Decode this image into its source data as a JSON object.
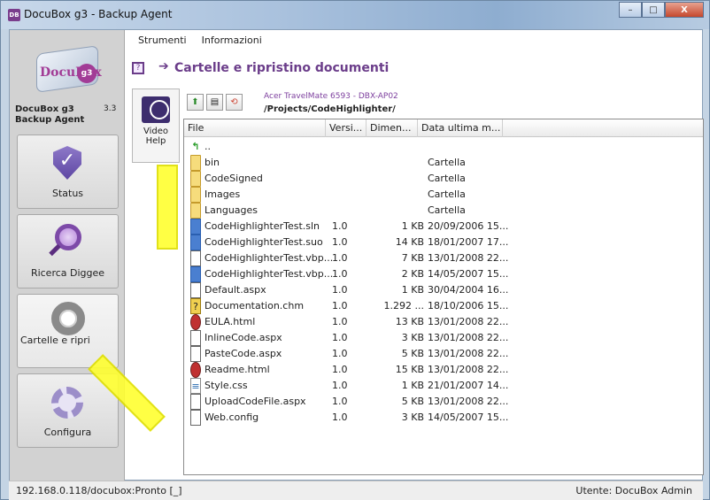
{
  "window": {
    "title": "DocuBox g3 - Backup Agent",
    "minimize_label": "–",
    "maximize_label": "□",
    "close_label": "X"
  },
  "menu": [
    {
      "label": "Strumenti"
    },
    {
      "label": "Informazioni"
    }
  ],
  "sidebar": {
    "logo_text": "DocuBox",
    "logo_badge": "g3",
    "app_name": "DocuBox g3 Backup Agent",
    "version": "3.3",
    "items": [
      {
        "label": "Status",
        "icon": "shield-check-icon"
      },
      {
        "label": "Ricerca Diggee",
        "icon": "magnifier-icon"
      },
      {
        "label": "Cartelle e ripri",
        "icon": "lifebuoy-icon"
      },
      {
        "label": "Configura",
        "icon": "gear-icon"
      }
    ]
  },
  "main": {
    "page_title": "Cartelle e ripristino documenti",
    "video_help_label": "Video Help",
    "machine": "Acer TravelMate 6593 - DBX-AP02",
    "path": "/Projects/CodeHighlighter/",
    "columns": {
      "file": "File",
      "version": "Versi...",
      "size": "Dimen...",
      "date": "Data ultima m..."
    },
    "files": [
      {
        "icon": "up",
        "name": "..",
        "version": "",
        "size": "",
        "date": ""
      },
      {
        "icon": "folder",
        "name": "bin",
        "version": "",
        "size": "",
        "date": "Cartella"
      },
      {
        "icon": "folder",
        "name": "CodeSigned",
        "version": "",
        "size": "",
        "date": "Cartella"
      },
      {
        "icon": "folder",
        "name": "Images",
        "version": "",
        "size": "",
        "date": "Cartella"
      },
      {
        "icon": "folder",
        "name": "Languages",
        "version": "",
        "size": "",
        "date": "Cartella"
      },
      {
        "icon": "sln",
        "name": "CodeHighlighterTest.sln",
        "version": "1.0",
        "size": "1 KB",
        "date": "20/09/2006 15..."
      },
      {
        "icon": "sln",
        "name": "CodeHighlighterTest.suo",
        "version": "1.0",
        "size": "14 KB",
        "date": "18/01/2007 17..."
      },
      {
        "icon": "doc",
        "name": "CodeHighlighterTest.vbp...",
        "version": "1.0",
        "size": "7 KB",
        "date": "13/01/2008 22..."
      },
      {
        "icon": "sln",
        "name": "CodeHighlighterTest.vbp...",
        "version": "1.0",
        "size": "2 KB",
        "date": "14/05/2007 15..."
      },
      {
        "icon": "doc",
        "name": "Default.aspx",
        "version": "1.0",
        "size": "1 KB",
        "date": "30/04/2004 16..."
      },
      {
        "icon": "help",
        "name": "Documentation.chm",
        "version": "1.0",
        "size": "1.292 ...",
        "date": "18/10/2006 15..."
      },
      {
        "icon": "html",
        "name": "EULA.html",
        "version": "1.0",
        "size": "13 KB",
        "date": "13/01/2008 22..."
      },
      {
        "icon": "doc",
        "name": "InlineCode.aspx",
        "version": "1.0",
        "size": "3 KB",
        "date": "13/01/2008 22..."
      },
      {
        "icon": "doc",
        "name": "PasteCode.aspx",
        "version": "1.0",
        "size": "5 KB",
        "date": "13/01/2008 22..."
      },
      {
        "icon": "html",
        "name": "Readme.html",
        "version": "1.0",
        "size": "15 KB",
        "date": "13/01/2008 22..."
      },
      {
        "icon": "css",
        "name": "Style.css",
        "version": "1.0",
        "size": "1 KB",
        "date": "21/01/2007 14..."
      },
      {
        "icon": "doc",
        "name": "UploadCodeFile.aspx",
        "version": "1.0",
        "size": "5 KB",
        "date": "13/01/2008 22..."
      },
      {
        "icon": "doc",
        "name": "Web.config",
        "version": "1.0",
        "size": "3 KB",
        "date": "14/05/2007 15..."
      }
    ]
  },
  "status": {
    "left": "192.168.0.118/docubox:Pronto [_]",
    "right": "Utente: DocuBox Admin"
  },
  "colors": {
    "accent": "#6b3d8a",
    "highlight_arrow": "#ffff30"
  }
}
